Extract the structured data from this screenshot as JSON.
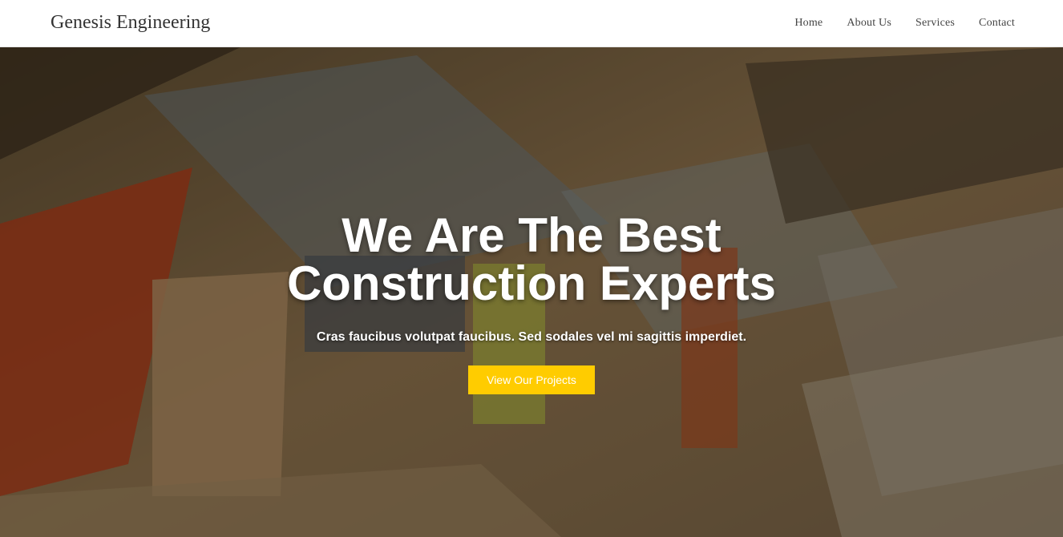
{
  "brand": {
    "name": "Genesis Engineering"
  },
  "nav": {
    "items": [
      {
        "label": "Home"
      },
      {
        "label": "About Us"
      },
      {
        "label": "Services"
      },
      {
        "label": "Contact"
      }
    ]
  },
  "hero": {
    "title_line1": "We Are The Best",
    "title_line2": "Construction Experts",
    "subtitle": "Cras faucibus volutpat faucibus. Sed sodales vel mi sagittis imperdiet.",
    "cta_label": "View Our Projects"
  },
  "colors": {
    "accent": "#ffcc00",
    "navbar_bg": "#ffffff",
    "text_dark": "#333333"
  }
}
